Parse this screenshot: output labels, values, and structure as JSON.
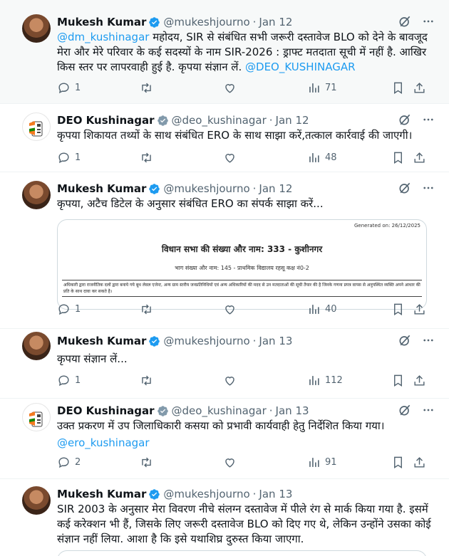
{
  "tweets": [
    {
      "name": "Mukesh Kumar",
      "handle": "@mukeshjourno",
      "date": "Jan 12",
      "mention_start": "@dm_kushinagar",
      "text": " महोदय, SIR से संबंधित सभी जरूरी दस्तावेज BLO को देने के बावजूद मेरा और मेरे परिवार के कई सदस्यों के नाम SIR-2026 : ड्राफ्ट मतदाता सूची में नहीं है. आखिर किस स्तर पर लापरवाही हुई है. कृपया संज्ञान लें. ",
      "mention_end": "@DEO_KUSHINAGAR",
      "replies": "1",
      "views": "71"
    },
    {
      "name": "DEO Kushinagar",
      "handle": "@deo_kushinagar",
      "date": "Jan 12",
      "text": "कृपया शिकायत तथ्यों के साथ संबंधित ERO के साथ साझा करें,तत्काल कार्रवाई की जाएगी।",
      "replies": "1",
      "views": "48"
    },
    {
      "name": "Mukesh Kumar",
      "handle": "@mukeshjourno",
      "date": "Jan 12",
      "text": "कृपया, अटैच डिटेल के अनुसार संबंधित ERO का संपर्क साझा करें...",
      "replies": "1",
      "views": "40",
      "attachment": {
        "generated": "Generated on: 26/12/2025",
        "title": "विधान सभा की संख्या और नाम: 333 - कुशीनगर",
        "subtitle": "भाग संख्या और नाम: 145 - प्राथमिक विद्यालय रहसू कक्ष नं0-2",
        "note": "अधिकारी द्वारा राजनीतिक दलों द्वारा बनाये गये बूथ लेवल एजेन्ट, अन्य ग्राम स्तरीय जनप्रतिनिधियों एवं अन्य अधिकारियों की मदद से उन मतदाताओं की सूची तैयार की है जिनके गणना प्रपत्र वापस से अनुपस्थित व्यक्ति अपने आधार की प्रति के साथ दावा कर सकते है।"
      }
    },
    {
      "name": "Mukesh Kumar",
      "handle": "@mukeshjourno",
      "date": "Jan 13",
      "text": "कृपया संज्ञान लें...",
      "replies": "1",
      "views": "112"
    },
    {
      "name": "DEO Kushinagar",
      "handle": "@deo_kushinagar",
      "date": "Jan 13",
      "text": "उक्त प्रकरण में उप जिलाधिकारी कसया को प्रभावी कार्यवाही हेतु निर्देशित किया गया।",
      "mention_line": "@ero_kushinagar",
      "replies": "2",
      "views": "91"
    },
    {
      "name": "Mukesh Kumar",
      "handle": "@mukeshjourno",
      "date": "Jan 13",
      "text": "SIR 2003 के अनुसार मेरा विवरण नीचे संलग्न दस्तावेज में पीले रंग से मार्क किया गया है. इसमें कई करेक्शन भी हैं, जिसके लिए जरूरी दस्तावेज BLO को दिए गए थे, लेकिन उन्होंने उसका कोई संज्ञान नहीं लिया. आशा है कि इसे यथाशिघ्र दुरुस्त किया जाएगा."
    }
  ],
  "separator": "·",
  "icons": {
    "verified": "verified-badge-icon",
    "grok": "grok-icon",
    "more": "more-icon",
    "reply": "reply-icon",
    "retweet": "retweet-icon",
    "like": "like-icon",
    "views": "views-icon",
    "bookmark": "bookmark-icon",
    "share": "share-icon"
  },
  "colors": {
    "link": "#1d9bf0",
    "secondary": "#536471",
    "verified": "#829aab",
    "highlight_bg": "#f7f9f9"
  }
}
